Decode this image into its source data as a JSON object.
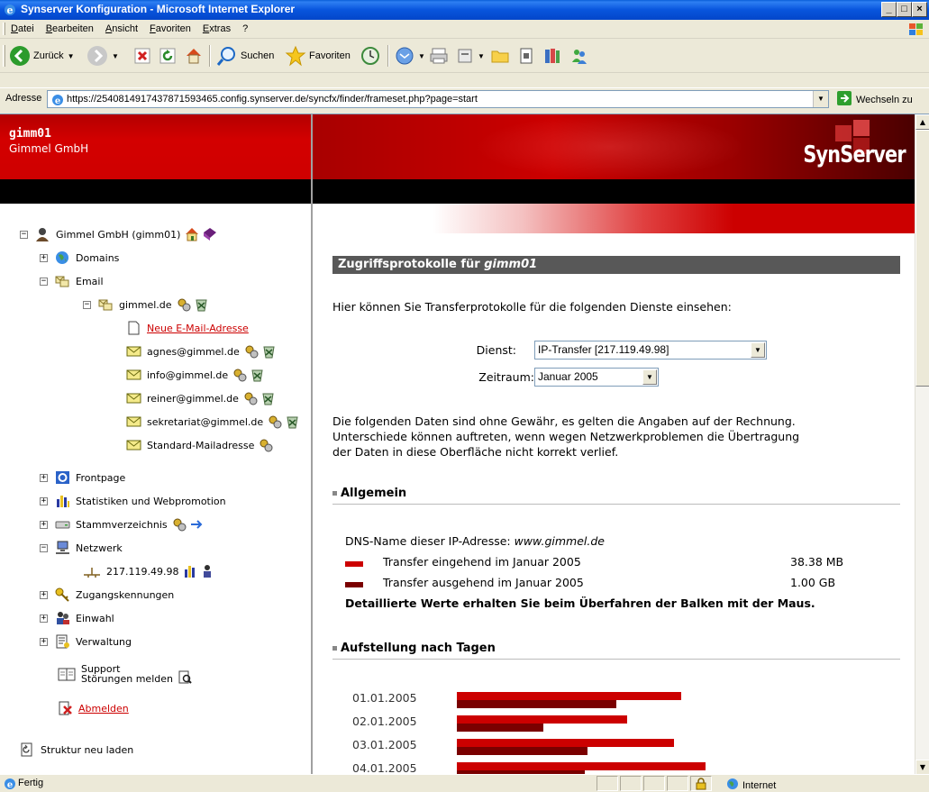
{
  "window": {
    "title": "Synserver Konfiguration - Microsoft Internet Explorer",
    "controls": [
      "_",
      "□",
      "×"
    ]
  },
  "menu": [
    "Datei",
    "Bearbeiten",
    "Ansicht",
    "Favoriten",
    "Extras",
    "?"
  ],
  "toolbar": {
    "back": "Zurück",
    "search": "Suchen",
    "favorites": "Favoriten"
  },
  "address": {
    "label": "Adresse",
    "url": "https://254081491743787159346​5.config.synserver.de/syncfx/finder/frameset.php?page=start",
    "go": "Wechseln zu"
  },
  "left": {
    "user": "gimm01",
    "company": "Gimmel GmbH",
    "tree": {
      "root": "Gimmel GmbH (gimm01)",
      "domains": "Domains",
      "email": "Email",
      "domain": "gimmel.de",
      "new_address": "Neue E-Mail-Adresse",
      "addresses": [
        "agnes@gimmel.de",
        "info@gimmel.de",
        "reiner@gimmel.de",
        "sekretariat@gimmel.de",
        "Standard-Mailadresse"
      ],
      "frontpage": "Frontpage",
      "stats": "Statistiken und Webpromotion",
      "rootdir": "Stammverzeichnis",
      "network": "Netzwerk",
      "ip": "217.119.49.98",
      "access": "Zugangskennungen",
      "dialin": "Einwahl",
      "admin": "Verwaltung",
      "support_1": "Support",
      "support_2": "Störungen melden",
      "logout": "Abmelden",
      "reload": "Struktur neu laden"
    }
  },
  "right": {
    "logo": "SynServer",
    "section_title_prefix": "Zugriffsprotokolle für ",
    "section_title_user": "gimm01",
    "intro": "Hier können Sie Transferprotokolle für die folgenden Dienste einsehen:",
    "service_label": "Dienst:",
    "service_value": "IP-Transfer [217.119.49.98]",
    "period_label": "Zeitraum:",
    "period_value": "Januar 2005",
    "disclaimer_1": "Die folgenden Daten sind ohne Gewähr, es gelten die Angaben auf der Rechnung.",
    "disclaimer_2": "Unterschiede können auftreten, wenn wegen Netzwerkproblemen die Übertragung",
    "disclaimer_3": "der Daten in diese Oberfläche nicht korrekt verlief.",
    "general_heading": "Allgemein",
    "dns_label": "DNS-Name dieser IP-Adresse: ",
    "dns_value": "www.gimmel.de",
    "in_label": "Transfer eingehend im Januar 2005",
    "in_value": "38.38 MB",
    "out_label": "Transfer ausgehend im Januar 2005",
    "out_value": "1.00 GB",
    "hint": "Detaillierte Werte erhalten Sie beim Überfahren der Balken mit der Maus.",
    "days_heading": "Aufstellung nach Tagen",
    "colors": {
      "incoming": "#cc0000",
      "outgoing": "#7a0000"
    }
  },
  "daily": [
    {
      "date": "01.01.2005",
      "incoming": 0.86,
      "outgoing": 0.61
    },
    {
      "date": "02.01.2005",
      "incoming": 0.65,
      "outgoing": 0.33
    },
    {
      "date": "03.01.2005",
      "incoming": 0.83,
      "outgoing": 0.5
    },
    {
      "date": "04.01.2005",
      "incoming": 0.95,
      "outgoing": 0.49
    }
  ],
  "status": {
    "text": "Fertig",
    "zone": "Internet"
  }
}
